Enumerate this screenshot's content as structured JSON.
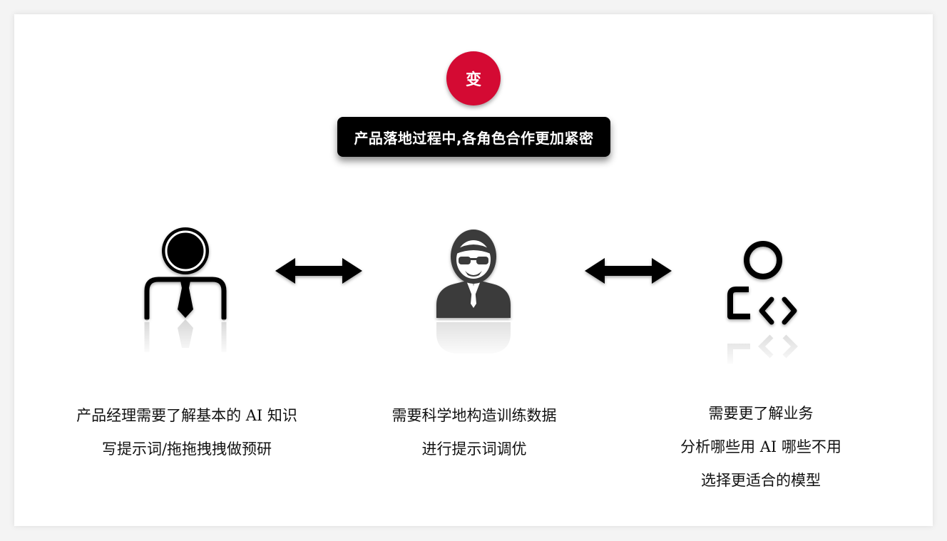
{
  "badge": {
    "label": "变",
    "color": "#d40a33"
  },
  "banner": {
    "text": "产品落地过程中,各角色合作更加紧密"
  },
  "roles": [
    {
      "icon": "business-person-icon",
      "lines": [
        "产品经理需要了解基本的 AI 知识",
        "写提示词/拖拖拽拽做预研"
      ]
    },
    {
      "icon": "engineer-person-icon",
      "lines": [
        "需要科学地构造训练数据",
        "进行提示词调优"
      ]
    },
    {
      "icon": "developer-code-icon",
      "lines": [
        "需要更了解业务",
        "分析哪些用 AI 哪些不用",
        "选择更适合的模型"
      ]
    }
  ],
  "connectors": [
    "double-arrow-icon",
    "double-arrow-icon"
  ]
}
